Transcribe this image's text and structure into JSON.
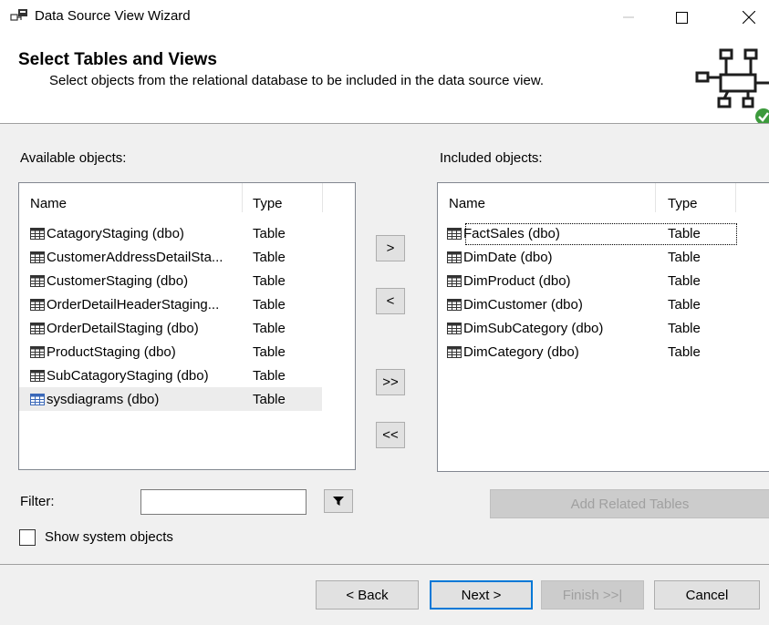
{
  "window": {
    "title": "Data Source View Wizard",
    "icon": "data-source-view-icon"
  },
  "header": {
    "title": "Select Tables and Views",
    "subtitle": "Select objects from the relational database to be included in the data source view.",
    "icon": "schema-check-icon"
  },
  "available": {
    "label": "Available objects:",
    "columns": {
      "name": "Name",
      "type": "Type"
    },
    "rows": [
      {
        "name": "CatagoryStaging (dbo)",
        "type": "Table"
      },
      {
        "name": "CustomerAddressDetailSta...",
        "type": "Table"
      },
      {
        "name": "CustomerStaging (dbo)",
        "type": "Table"
      },
      {
        "name": "OrderDetailHeaderStaging...",
        "type": "Table"
      },
      {
        "name": "OrderDetailStaging (dbo)",
        "type": "Table"
      },
      {
        "name": "ProductStaging (dbo)",
        "type": "Table"
      },
      {
        "name": "SubCatagoryStaging (dbo)",
        "type": "Table"
      },
      {
        "name": "sysdiagrams (dbo)",
        "type": "Table"
      }
    ]
  },
  "included": {
    "label": "Included objects:",
    "columns": {
      "name": "Name",
      "type": "Type"
    },
    "rows": [
      {
        "name": "FactSales (dbo)",
        "type": "Table"
      },
      {
        "name": "DimDate (dbo)",
        "type": "Table"
      },
      {
        "name": "DimProduct (dbo)",
        "type": "Table"
      },
      {
        "name": "DimCustomer (dbo)",
        "type": "Table"
      },
      {
        "name": "DimSubCategory (dbo)",
        "type": "Table"
      },
      {
        "name": "DimCategory (dbo)",
        "type": "Table"
      }
    ]
  },
  "move_buttons": {
    "add": ">",
    "remove": "<",
    "add_all": ">>",
    "remove_all": "<<"
  },
  "filter": {
    "label": "Filter:",
    "value": "",
    "button_icon": "funnel-icon"
  },
  "add_related_label": "Add Related Tables",
  "show_system": {
    "label": "Show system objects",
    "checked": false
  },
  "footer": {
    "back": "< Back",
    "next": "Next >",
    "finish": "Finish >>|",
    "cancel": "Cancel"
  },
  "colors": {
    "accent": "#0078d7",
    "icon_check": "#3c9a3c"
  }
}
